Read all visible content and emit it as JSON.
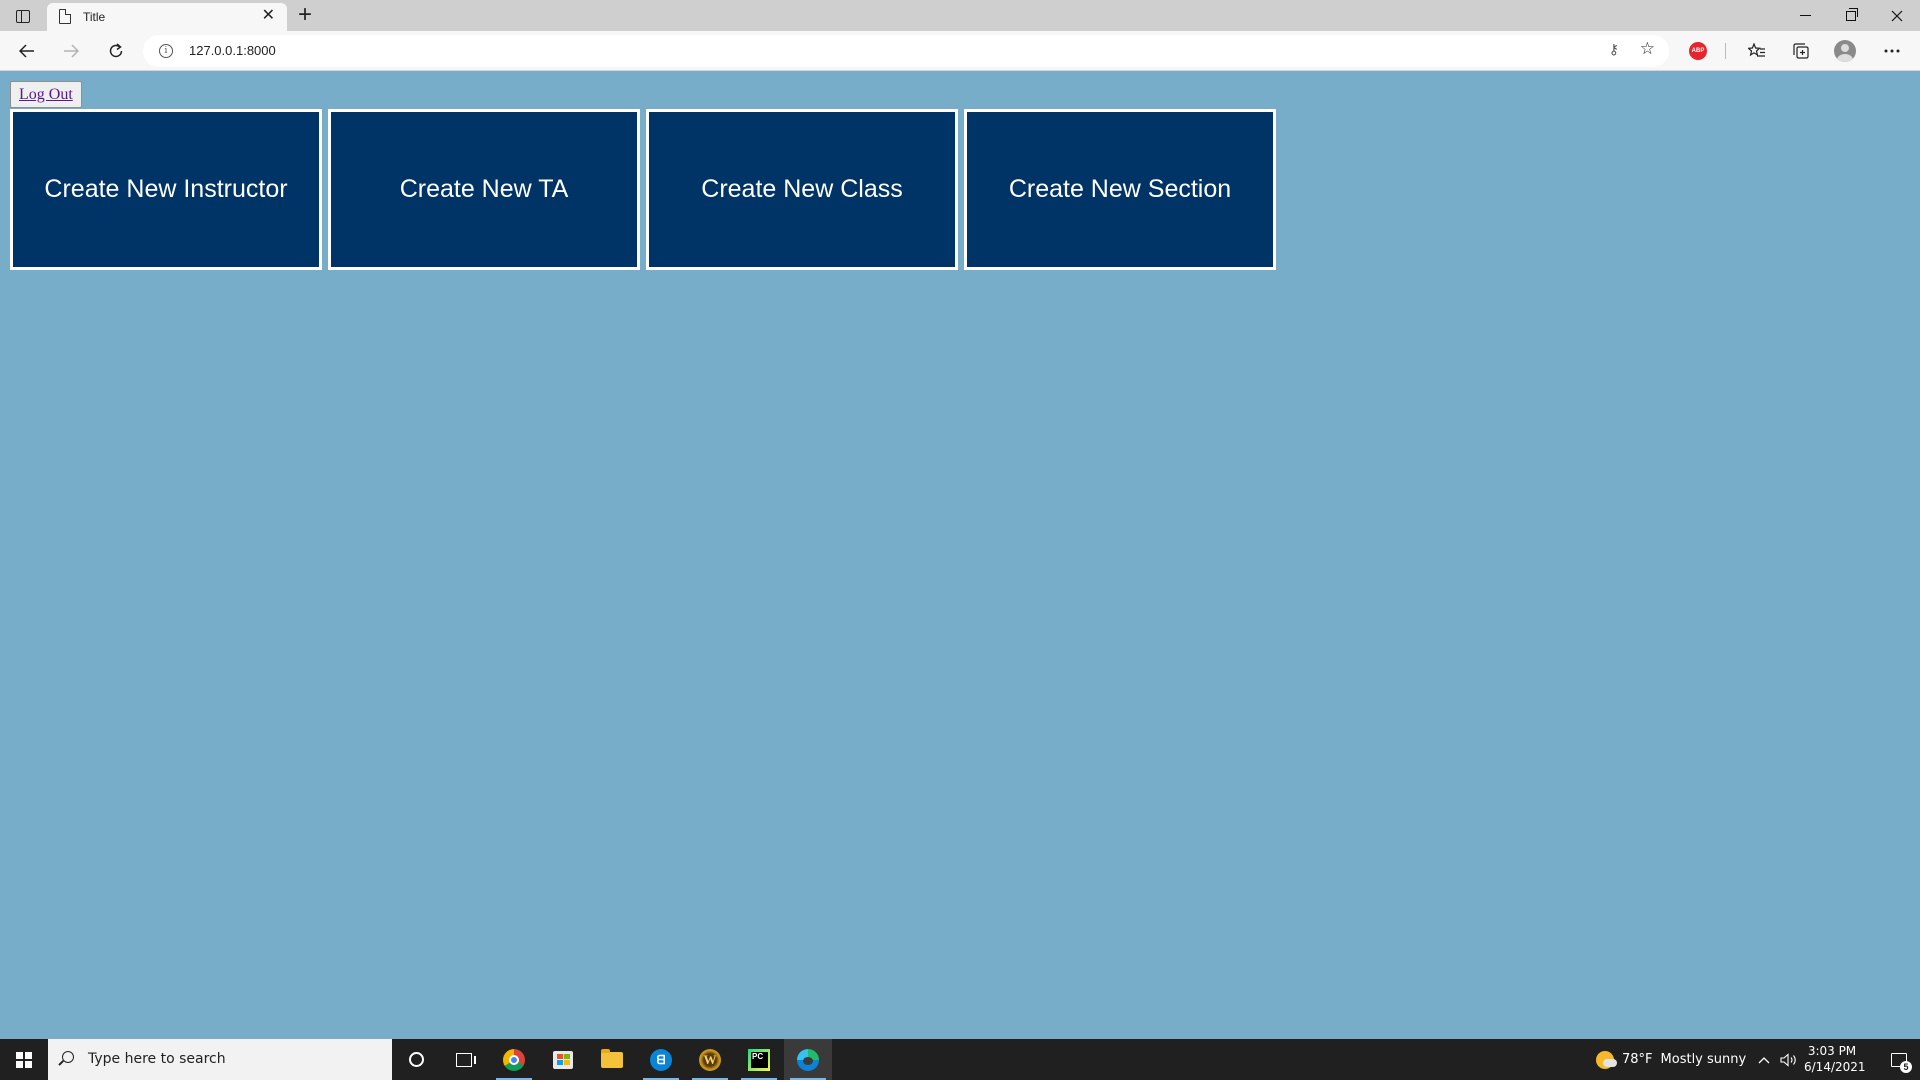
{
  "browser": {
    "tab_title": "Title",
    "tab_close": "✕",
    "new_tab": "+",
    "url": "127.0.0.1:8000",
    "abp_label": "ABP"
  },
  "page": {
    "logout_label": "Log Out",
    "cards": [
      {
        "label": "Create New Instructor"
      },
      {
        "label": "Create New TA"
      },
      {
        "label": "Create New Class"
      },
      {
        "label": "Create New Section"
      }
    ],
    "colors": {
      "background": "#78adc9",
      "card": "#003366",
      "card_border": "#ffffff",
      "card_text": "#ffffff"
    }
  },
  "taskbar": {
    "search_placeholder": "Type here to search",
    "weather": {
      "temp": "78°F",
      "condition": "Mostly sunny"
    },
    "time": "3:03 PM",
    "date": "6/14/2021",
    "notification_count": "5",
    "icons": [
      "windows-start-icon",
      "cortana-icon",
      "task-view-icon",
      "chrome-icon",
      "store-icon",
      "file-explorer-icon",
      "battle-net-icon",
      "world-of-warcraft-icon",
      "pycharm-icon",
      "edge-icon"
    ]
  }
}
